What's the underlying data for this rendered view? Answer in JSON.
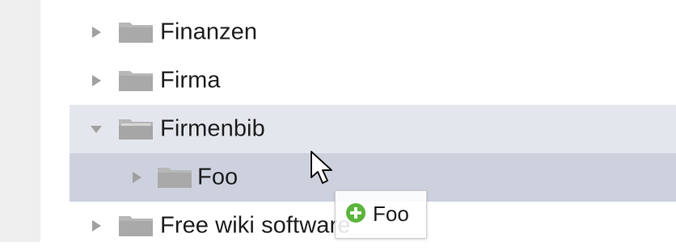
{
  "tree": {
    "items": [
      {
        "label": "Finanzen",
        "expanded": false,
        "selected": false,
        "depth": 0
      },
      {
        "label": "Firma",
        "expanded": false,
        "selected": false,
        "depth": 0
      },
      {
        "label": "Firmenbib",
        "expanded": true,
        "selected": false,
        "depth": 0
      },
      {
        "label": "Foo",
        "expanded": false,
        "selected": true,
        "depth": 1
      },
      {
        "label": "Free wiki software",
        "expanded": false,
        "selected": false,
        "depth": 0
      }
    ]
  },
  "drag": {
    "label": "Foo",
    "icon": "plus-circle-icon"
  },
  "icons": {
    "toggle": "triangle-toggle-icon",
    "folder": "folder-icon",
    "cursor": "mouse-pointer-icon"
  },
  "colors": {
    "hover_row": "#e4e6ee",
    "selected_row": "#cdd1de",
    "folder": "#b7b7b7",
    "toggle": "#a0a0a0",
    "add_icon": "#5bb43c"
  }
}
